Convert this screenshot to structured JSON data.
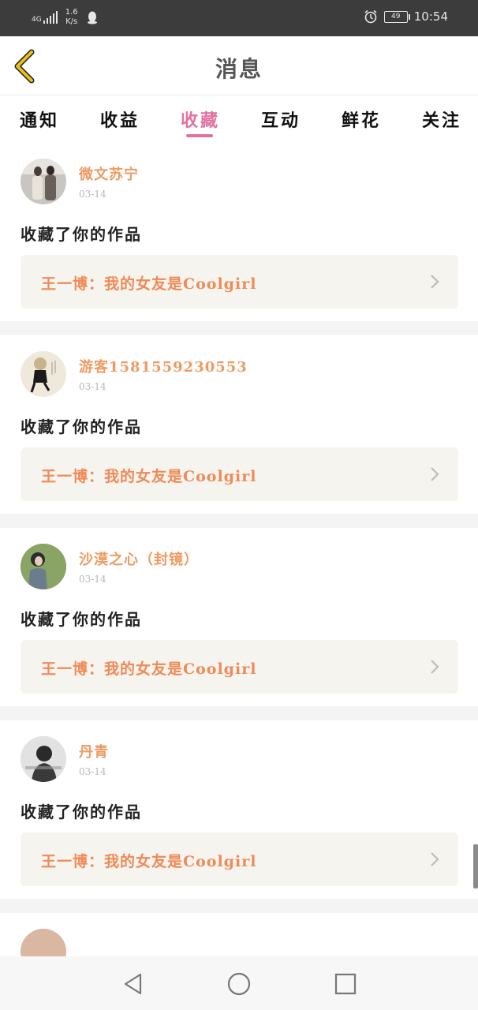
{
  "status_bar": {
    "network_type": "4G",
    "speed_value": "1.6",
    "speed_unit": "K/s",
    "battery": "49",
    "time": "10:54"
  },
  "header": {
    "title": "消息"
  },
  "tabs": [
    {
      "label": "通知",
      "active": false
    },
    {
      "label": "收益",
      "active": false
    },
    {
      "label": "收藏",
      "active": true
    },
    {
      "label": "互动",
      "active": false
    },
    {
      "label": "鲜花",
      "active": false
    },
    {
      "label": "关注",
      "active": false
    }
  ],
  "messages": [
    {
      "username": "微文苏宁",
      "date": "03-14",
      "action": "收藏了你的作品",
      "work_title": "王一博：我的女友是Coolgirl"
    },
    {
      "username": "游客1581559230553",
      "date": "03-14",
      "action": "收藏了你的作品",
      "work_title": "王一博：我的女友是Coolgirl"
    },
    {
      "username": "沙漠之心（封镜）",
      "date": "03-14",
      "action": "收藏了你的作品",
      "work_title": "王一博：我的女友是Coolgirl"
    },
    {
      "username": "丹青",
      "date": "03-14",
      "action": "收藏了你的作品",
      "work_title": "王一博：我的女友是Coolgirl"
    }
  ],
  "colors": {
    "accent_pink": "#e371a0",
    "username_orange": "#ee9b63",
    "work_title_orange": "#f08a57",
    "back_arrow_yellow": "#e8c21a"
  },
  "icons": {
    "back": "back-arrow-icon",
    "chevron": "chevron-right-icon",
    "nav_back": "triangle-back-icon",
    "nav_home": "circle-home-icon",
    "nav_recent": "square-recent-icon"
  }
}
